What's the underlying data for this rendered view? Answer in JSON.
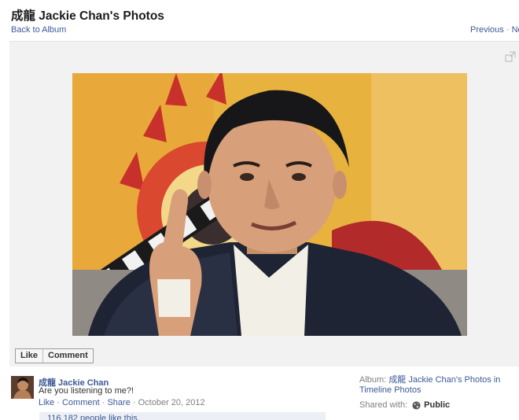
{
  "header": {
    "title": "成龍 Jackie Chan's Photos",
    "back_label": "Back to Album",
    "previous_label": "Previous",
    "separator": "·",
    "next_label": "Next"
  },
  "photo_actions": {
    "like_label": "Like",
    "comment_label": "Comment"
  },
  "post": {
    "author": "成龍 Jackie Chan",
    "caption": "Are you listening to me?!",
    "like_label": "Like",
    "comment_label": "Comment",
    "share_label": "Share",
    "separator": "·",
    "date": "October 20, 2012",
    "likes_text": "116,182 people like this."
  },
  "sidebar": {
    "album_prefix": "Album:",
    "album_name": "成龍 Jackie Chan's Photos in Timeline Photos",
    "shared_label": "Shared with:",
    "privacy": "Public"
  },
  "icons": {
    "expand": "expand-icon",
    "globe": "globe-icon"
  },
  "colors": {
    "link": "#3b5998",
    "muted": "#7f7f7f",
    "stage_bg": "#f2f2f2",
    "photo_bg": "#e9b640"
  }
}
